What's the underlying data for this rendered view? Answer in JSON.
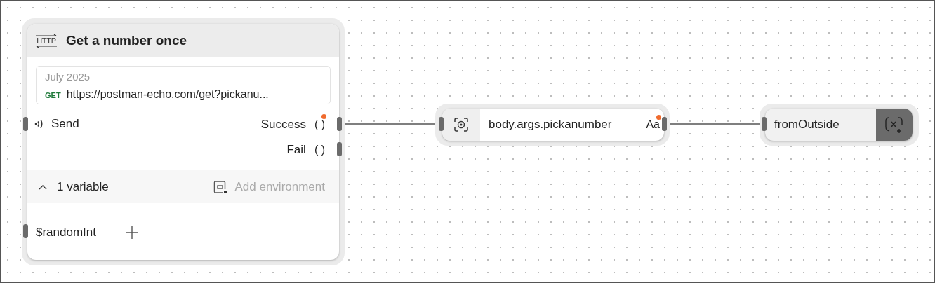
{
  "http_node": {
    "icon_text": "HTTP",
    "title": "Get a number once",
    "date": "July 2025",
    "method": "GET",
    "url": "https://postman-echo.com/get?pickanu...",
    "input": "Send",
    "outputs": [
      {
        "label": "Success",
        "symbol": "( )",
        "pending": true
      },
      {
        "label": "Fail",
        "symbol": "( )",
        "pending": false
      }
    ],
    "variables": {
      "expanded": true,
      "count": "1 variable",
      "add": "Add environment",
      "items": [
        {
          "name": "$randomInt"
        }
      ]
    }
  },
  "select_node": {
    "path": "body.args.pickanumber",
    "type": "Aa",
    "pending": true
  },
  "variable_node": {
    "name": "fromOutside"
  }
}
